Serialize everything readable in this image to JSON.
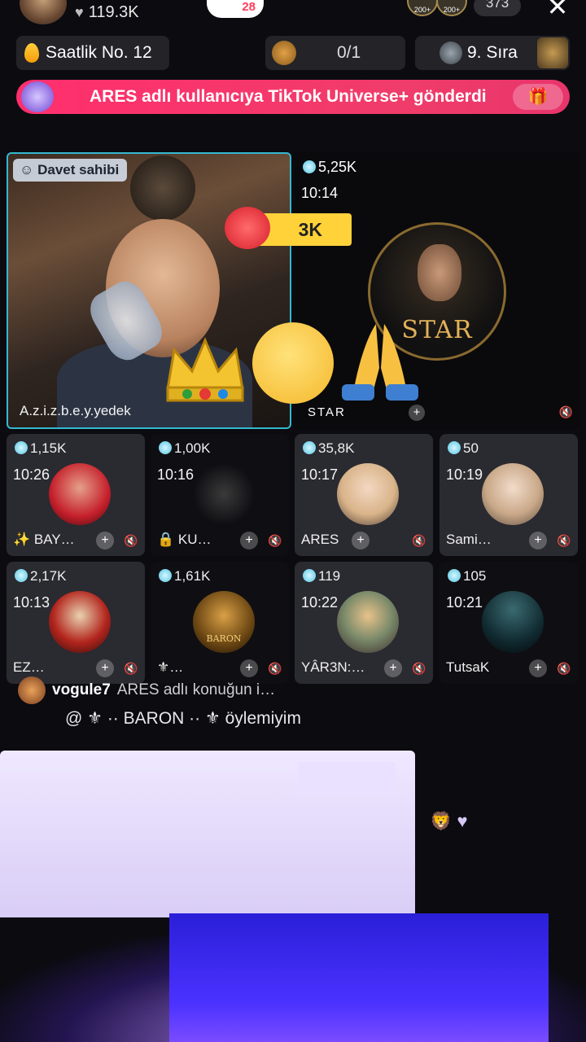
{
  "header": {
    "likes": "119.3K",
    "gift_count": "28",
    "viewer_count": "373",
    "viewer_badges": [
      "200+",
      "200+"
    ]
  },
  "stats": {
    "hourly_rank": "Saatlik No. 12",
    "battle_score": "0/1",
    "rank_position": "9. Sıra"
  },
  "banner": {
    "text": "ARES adlı kullanıcıya TikTok Universe+ gönderdi"
  },
  "host_tile": {
    "badge": "Davet sahibi",
    "name": "A.z.i.z.b.e.y.yedek"
  },
  "gift_overlay": {
    "amount": "3K"
  },
  "star_tile": {
    "score": "5,25K",
    "time": "10:14",
    "logo_text": "STAR",
    "name": "STAR"
  },
  "guests": [
    {
      "score": "1,15K",
      "time": "10:26",
      "name": "✨ BAY…"
    },
    {
      "score": "1,00K",
      "time": "10:16",
      "name": "🔒 KU…"
    },
    {
      "score": "35,8K",
      "time": "10:17",
      "name": "ARES"
    },
    {
      "score": "50",
      "time": "10:19",
      "name": "Sami…"
    },
    {
      "score": "2,17K",
      "time": "10:13",
      "name": "EZ…"
    },
    {
      "score": "1,61K",
      "time": "",
      "name": "⚜…"
    },
    {
      "score": "119",
      "time": "10:22",
      "name": "YÂR3N:…"
    },
    {
      "score": "105",
      "time": "10:21",
      "name": "TutsaK"
    }
  ],
  "guest_avatar_labels": {
    "baron": "BARON"
  },
  "comments": [
    {
      "user": "vogule7",
      "text": "ARES adlı konuğun i…"
    }
  ],
  "mention": {
    "text": "@ ⚜ ·· BARON ·· ⚜ öylemiyim"
  },
  "colors": {
    "host_border": "#35b8d0",
    "banner": "#f03c6a",
    "gift_bubble": "#ffd23a",
    "coin": "#52c6e2"
  },
  "icons": [
    "heart-icon",
    "close-icon",
    "flame-icon",
    "lion-icon",
    "gift-icon",
    "coin-icon",
    "plus-icon",
    "mute-icon",
    "crown-icon",
    "pray-icon"
  ]
}
